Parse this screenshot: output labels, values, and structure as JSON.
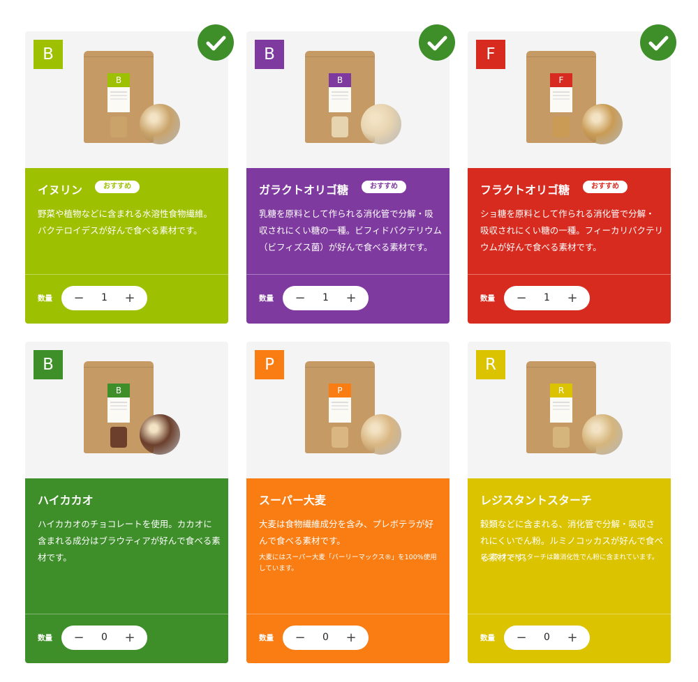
{
  "common": {
    "qty_label": "数量",
    "minus": "−",
    "plus": "+",
    "recommended": "おすすめ",
    "checked_icon": "check-circle-icon"
  },
  "products": [
    {
      "letter": "B",
      "color": "#9dc000",
      "name": "イヌリン",
      "recommended": true,
      "selected": true,
      "desc": "野菜や植物などに含まれる水溶性食物繊維。バクテロイデスが好んで食べる素材です。",
      "note": "",
      "qty": "1"
    },
    {
      "letter": "B",
      "color": "#7f3aa0",
      "name": "ガラクトオリゴ糖",
      "recommended": true,
      "selected": true,
      "desc": "乳糖を原料として作られる消化管で分解・吸収されにくい糖の一種。ビフィドバクテリウム（ビフィズス菌）が好んで食べる素材です。",
      "note": "",
      "qty": "1"
    },
    {
      "letter": "F",
      "color": "#d82b1f",
      "name": "フラクトオリゴ糖",
      "recommended": true,
      "selected": true,
      "desc": "ショ糖を原料として作られる消化管で分解・吸収されにくい糖の一種。フィーカリバクテリウムが好んで食べる素材です。",
      "note": "",
      "qty": "1"
    },
    {
      "letter": "B",
      "color": "#3e8e2a",
      "name": "ハイカカオ",
      "recommended": false,
      "selected": false,
      "desc": "ハイカカオのチョコレートを使用。カカオに含まれる成分はブラウティアが好んで食べる素材です。",
      "note": "",
      "qty": "0"
    },
    {
      "letter": "P",
      "color": "#f97d13",
      "name": "スーパー大麦",
      "recommended": false,
      "selected": false,
      "desc": "大麦は食物繊維成分を含み、プレボテラが好んで食べる素材です。",
      "note": "大麦にはスーパー大麦「バーリーマックス®」を100%使用しています。",
      "qty": "0"
    },
    {
      "letter": "R",
      "color": "#dcc300",
      "name": "レジスタントスターチ",
      "recommended": false,
      "selected": false,
      "desc": "穀類などに含まれる、消化管で分解・吸収されにくいでん粉。ルミノコッカスが好んで食べる素材です。",
      "note": "レジスタントスターチは難消化性でん粉に含まれています。",
      "qty": "0"
    }
  ]
}
